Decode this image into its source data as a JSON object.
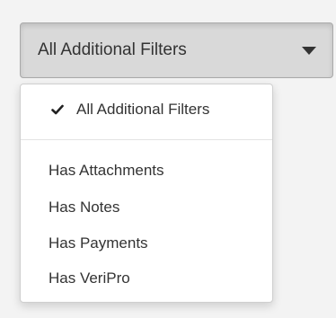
{
  "filter": {
    "selected_label": "All Additional Filters"
  },
  "menu": {
    "items": [
      {
        "label": "All Additional Filters",
        "selected": true
      },
      {
        "label": "Has Attachments",
        "selected": false
      },
      {
        "label": "Has Notes",
        "selected": false
      },
      {
        "label": "Has Payments",
        "selected": false
      },
      {
        "label": "Has VeriPro",
        "selected": false
      }
    ]
  },
  "icons": {
    "toggle": "caret-down-icon",
    "selected": "checkmark-icon"
  }
}
